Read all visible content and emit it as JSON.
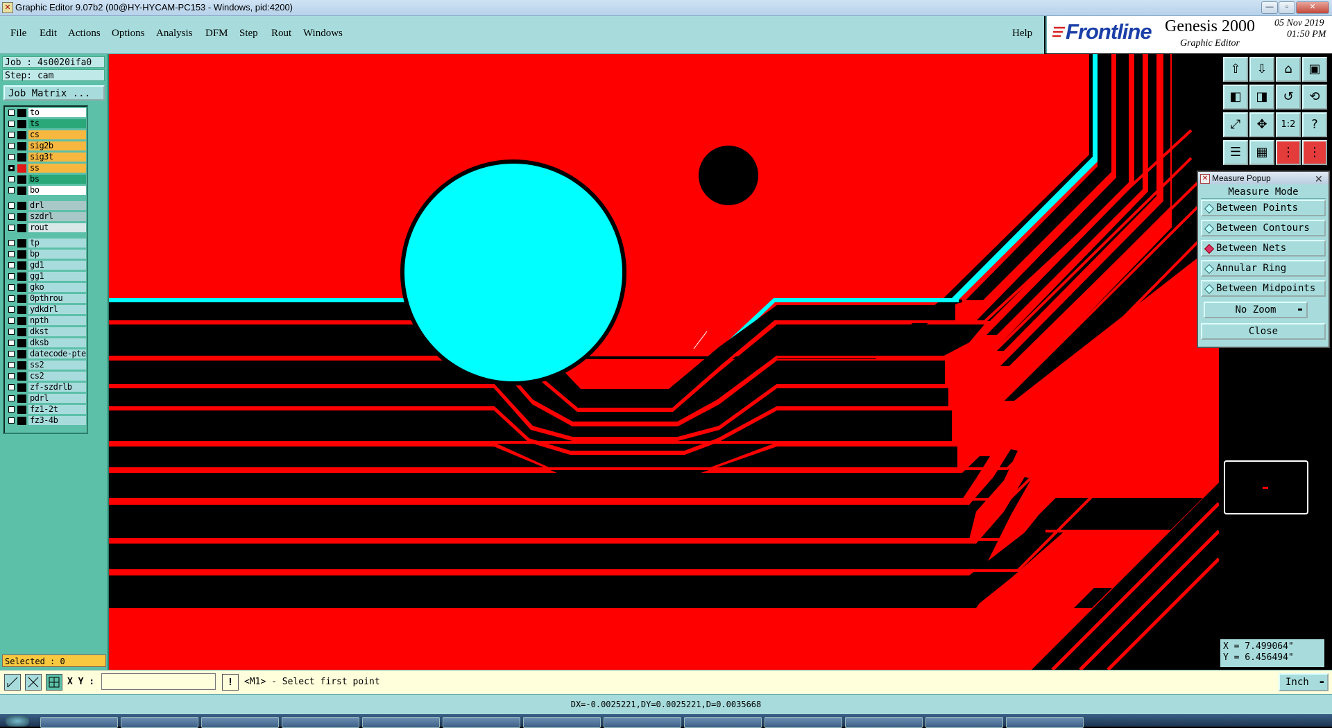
{
  "window": {
    "title": "Graphic Editor 9.07b2 (00@HY-HYCAM-PC153 - Windows, pid:4200)",
    "min_label": "—",
    "max_label": "▫",
    "close_label": "✕"
  },
  "menu": {
    "items": [
      "File",
      "Edit",
      "Actions",
      "Options",
      "Analysis",
      "DFM",
      "Step",
      "Rout",
      "Windows"
    ],
    "help": "Help"
  },
  "brand": {
    "logo": "Frontline",
    "product": "Genesis 2000",
    "subtitle": "Graphic Editor",
    "date": "05 Nov 2019",
    "time": "01:50 PM"
  },
  "left": {
    "job": "Job : 4s0020ifa0",
    "step": "Step: cam",
    "job_matrix": "Job Matrix ...",
    "selected": "Selected : 0",
    "layers": [
      {
        "name": "to",
        "color": "#ffffff",
        "mark": "⇙"
      },
      {
        "name": "ts",
        "color": "#2aa87a",
        "mark": ""
      },
      {
        "name": "cs",
        "color": "#f8b840",
        "mark": "⇙"
      },
      {
        "name": "sig2b",
        "color": "#f8b840",
        "mark": "⇙"
      },
      {
        "name": "sig3t",
        "color": "#f8b840",
        "mark": "⇙"
      },
      {
        "name": "ss",
        "color": "#f8b840",
        "mark": "⇙▣",
        "active": true
      },
      {
        "name": "bs",
        "color": "#2aa87a",
        "mark": ""
      },
      {
        "name": "bo",
        "color": "#ffffff",
        "mark": "⇙"
      },
      {
        "name": "drl",
        "color": "#a8c8c8",
        "mark": ""
      },
      {
        "name": "szdrl",
        "color": "#a8c8c8",
        "mark": ""
      },
      {
        "name": "rout",
        "color": "#d8e8e8",
        "mark": ""
      },
      {
        "name": "tp",
        "color": "#a8dcdc",
        "mark": ""
      },
      {
        "name": "bp",
        "color": "#a8dcdc",
        "mark": ""
      },
      {
        "name": "gd1",
        "color": "#a8dcdc",
        "mark": "⇙"
      },
      {
        "name": "gg1",
        "color": "#a8dcdc",
        "mark": "⇙"
      },
      {
        "name": "gko",
        "color": "#a8dcdc",
        "mark": "⇙"
      },
      {
        "name": "0pthrou",
        "color": "#a8dcdc",
        "mark": ""
      },
      {
        "name": "ydkdrl",
        "color": "#a8dcdc",
        "mark": ""
      },
      {
        "name": "npth",
        "color": "#a8dcdc",
        "mark": ""
      },
      {
        "name": "dkst",
        "color": "#a8dcdc",
        "mark": ""
      },
      {
        "name": "dksb",
        "color": "#a8dcdc",
        "mark": ""
      },
      {
        "name": "datecode-pte",
        "color": "#a8dcdc",
        "mark": ""
      },
      {
        "name": "ss2",
        "color": "#a8dcdc",
        "mark": ""
      },
      {
        "name": "cs2",
        "color": "#a8dcdc",
        "mark": ""
      },
      {
        "name": "zf-szdrlb",
        "color": "#a8dcdc",
        "mark": ""
      },
      {
        "name": "pdrl",
        "color": "#a8dcdc",
        "mark": ""
      },
      {
        "name": "fz1-2t",
        "color": "#a8dcdc",
        "mark": ""
      },
      {
        "name": "fz3-4b",
        "color": "#a8dcdc",
        "mark": ""
      }
    ]
  },
  "toolbar_icons": [
    "open-job-icon",
    "close-job-icon",
    "home-icon",
    "split-view-icon",
    "undo-icon",
    "redo-icon",
    "zoom-back-icon",
    "snap-icon",
    "fit-screen-icon",
    "fit-profile-icon",
    "one-to-one-icon",
    "help-icon",
    "layers-icon",
    "grid-icon",
    "measure-icon",
    "graph-tools-icon"
  ],
  "toolbar_labels": {
    "one_to_one": "1:2",
    "help": "?"
  },
  "measure": {
    "title": "Measure Popup",
    "mode_label": "Measure Mode",
    "options": [
      "Between Points",
      "Between Contours",
      "Between Nets",
      "Annular Ring",
      "Between Midpoints"
    ],
    "selected": "Between Nets",
    "zoom": "No Zoom",
    "close": "Close"
  },
  "coords": {
    "x": "X = 7.499064\"",
    "y": "Y = 6.456494\""
  },
  "command": {
    "xy_label": "X Y :",
    "xy_value": "",
    "prompt": "<M1> - Select first point",
    "units": "Inch"
  },
  "status": {
    "text": "DX=-0.0025221,DY=0.0025221,D=0.0035668"
  },
  "colors": {
    "canvas_red": "#ff0000",
    "trace_black": "#000000",
    "pad_cyan": "#00ffff",
    "panel_teal": "#a8dcdc"
  }
}
